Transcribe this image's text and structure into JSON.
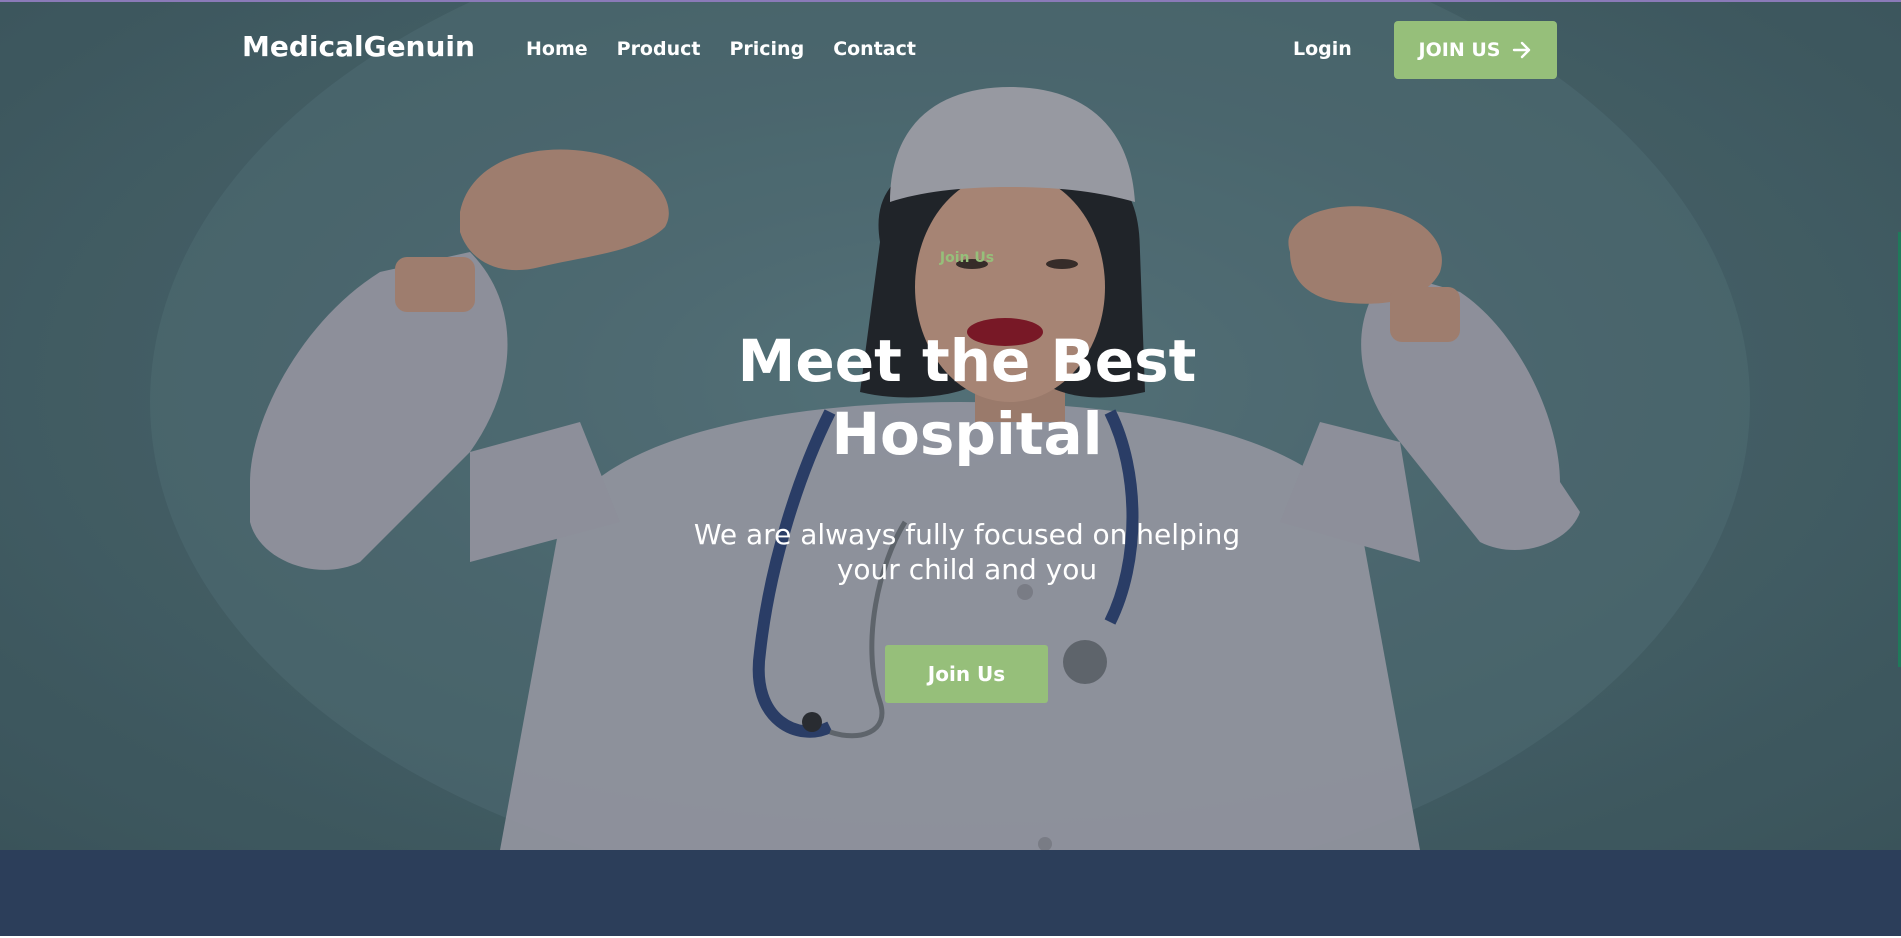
{
  "header": {
    "brand": "MedicalGenuin",
    "nav": [
      {
        "label": "Home"
      },
      {
        "label": "Product"
      },
      {
        "label": "Pricing"
      },
      {
        "label": "Contact"
      }
    ],
    "login_label": "Login",
    "join_label": "JOIN US",
    "join_icon": "arrow-right-icon"
  },
  "hero": {
    "eyebrow": "Join Us",
    "title": "Meet the Best Hospital",
    "subtitle": "We are always fully focused on helping your child and you",
    "cta_label": "Join Us",
    "image": "doctor-flexing-photo"
  },
  "colors": {
    "accent": "#96bf7a",
    "hero_bg": "#4c6a70",
    "bottom_band": "#2c3e5a",
    "text_light": "#ffffff"
  }
}
